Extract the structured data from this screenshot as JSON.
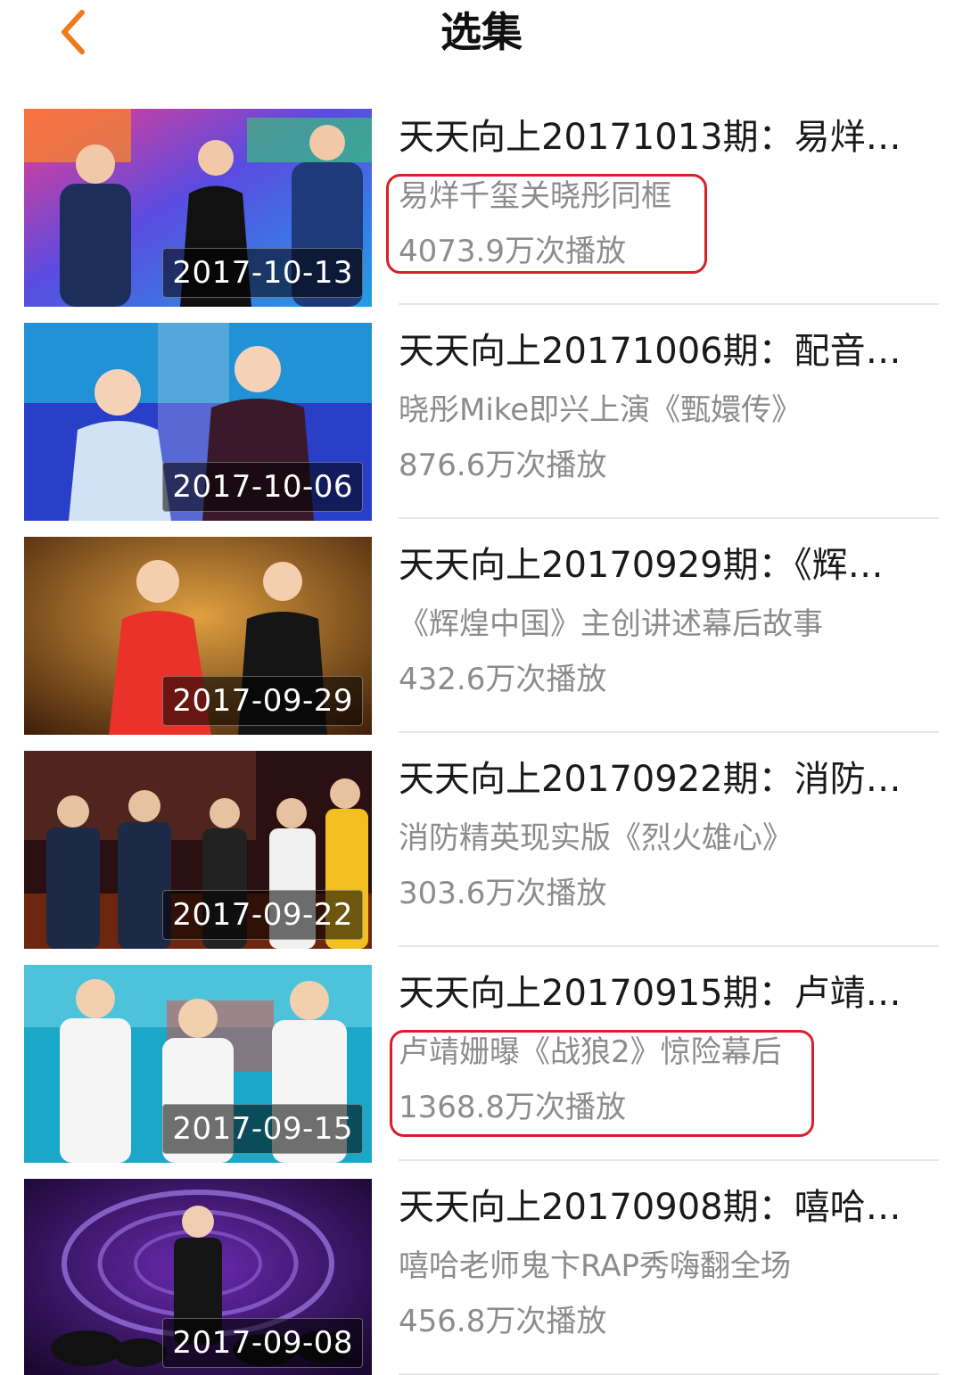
{
  "header": {
    "title": "选集",
    "back_icon": "chevron-left-icon",
    "accent_color": "#f07a1a"
  },
  "episodes": [
    {
      "title": "天天向上20171013期：易烊…",
      "description": "易烊千玺关晓彤同框",
      "plays": "4073.9万次播放",
      "date": "2017-10-13",
      "highlighted": true
    },
    {
      "title": "天天向上20171006期：配音…",
      "description": "晓彤Mike即兴上演《甄嬛传》",
      "plays": "876.6万次播放",
      "date": "2017-10-06",
      "highlighted": false
    },
    {
      "title": "天天向上20170929期：《辉…",
      "description": "《辉煌中国》主创讲述幕后故事",
      "plays": "432.6万次播放",
      "date": "2017-09-29",
      "highlighted": false
    },
    {
      "title": "天天向上20170922期：消防…",
      "description": "消防精英现实版《烈火雄心》",
      "plays": "303.6万次播放",
      "date": "2017-09-22",
      "highlighted": false
    },
    {
      "title": "天天向上20170915期：卢靖…",
      "description": "卢靖姗曝《战狼2》惊险幕后",
      "plays": "1368.8万次播放",
      "date": "2017-09-15",
      "highlighted": true
    },
    {
      "title": "天天向上20170908期：嘻哈…",
      "description": "嘻哈老师鬼卞RAP秀嗨翻全场",
      "plays": "456.8万次播放",
      "date": "2017-09-08",
      "highlighted": false
    }
  ],
  "highlight_color": "#d8202a"
}
